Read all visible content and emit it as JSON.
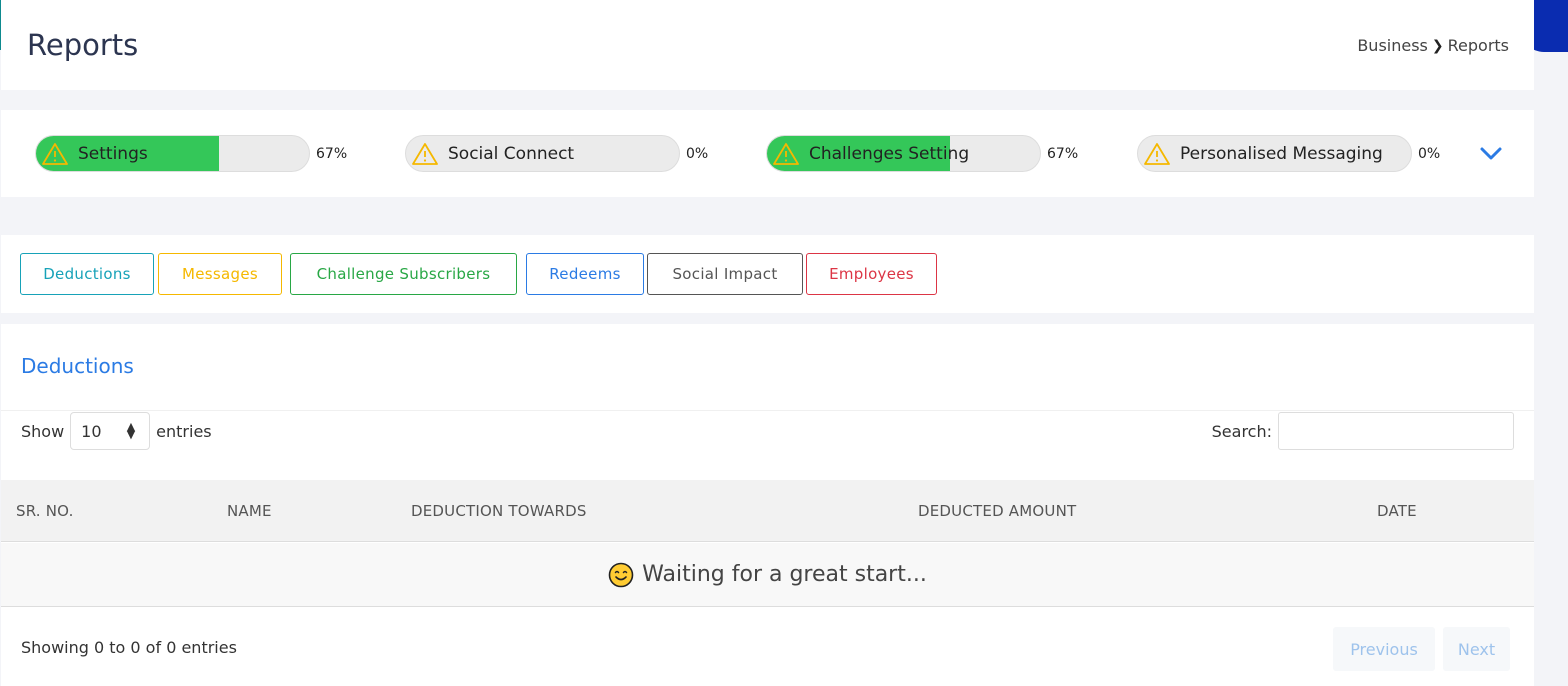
{
  "header": {
    "title": "Reports",
    "breadcrumb": [
      "Business",
      "Reports"
    ]
  },
  "progress": [
    {
      "label": "Settings",
      "percent_text": "67%",
      "fill": 0.67
    },
    {
      "label": "Social Connect",
      "percent_text": "0%",
      "fill": 0
    },
    {
      "label": "Challenges Setting",
      "percent_text": "67%",
      "fill": 0.67
    },
    {
      "label": "Personalised Messaging",
      "percent_text": "0%",
      "fill": 0
    }
  ],
  "tabs": [
    {
      "label": "Deductions",
      "color": "#17a2b8"
    },
    {
      "label": "Messages",
      "color": "#f5b800"
    },
    {
      "label": "Challenge Subscribers",
      "color": "#28a745"
    },
    {
      "label": "Redeems",
      "color": "#2b7be4"
    },
    {
      "label": "Social Impact",
      "color": "#555555"
    },
    {
      "label": "Employees",
      "color": "#dc3545"
    }
  ],
  "table": {
    "title": "Deductions",
    "show_label": "Show",
    "entries_value": "10",
    "entries_label": "entries",
    "search_label": "Search:",
    "search_value": "",
    "columns": [
      "SR. NO.",
      "NAME",
      "DEDUCTION TOWARDS",
      "DEDUCTED AMOUNT",
      "DATE"
    ],
    "empty_message": "Waiting for a great start...",
    "info": "Showing 0 to 0 of 0 entries",
    "pagination": {
      "previous": "Previous",
      "next": "Next"
    }
  },
  "colors": {
    "accent_blue": "#2b7be4",
    "progress_green": "#34c759",
    "warning_yellow": "#f5b800"
  }
}
